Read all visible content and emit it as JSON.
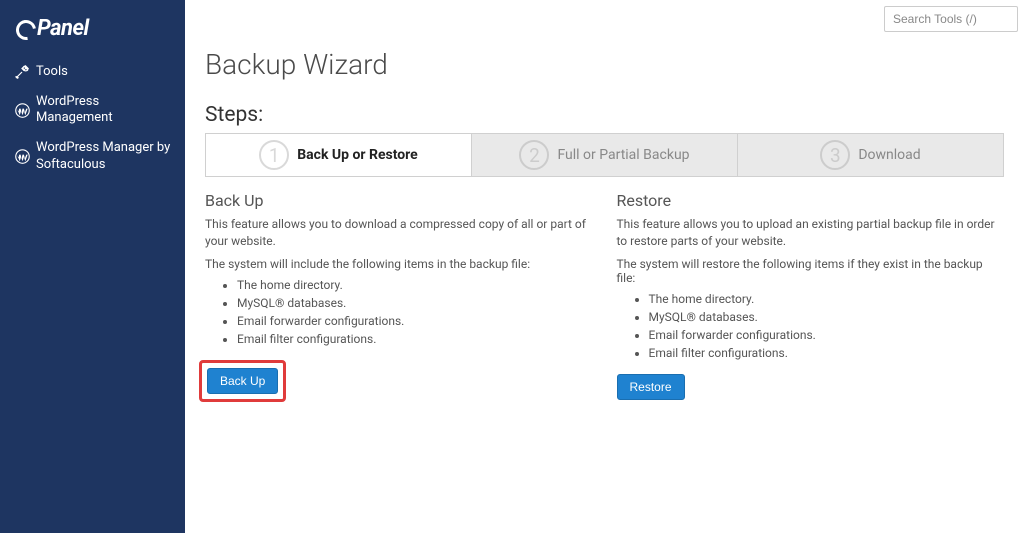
{
  "brand": {
    "name": "cPanel"
  },
  "search": {
    "placeholder": "Search Tools (/)"
  },
  "sidebar": {
    "items": [
      {
        "label": "Tools"
      },
      {
        "label": "WordPress Management"
      },
      {
        "label": "WordPress Manager by Softaculous"
      }
    ]
  },
  "page": {
    "title": "Backup Wizard",
    "steps_label": "Steps:"
  },
  "steps": [
    {
      "num": "1",
      "label": "Back Up or Restore"
    },
    {
      "num": "2",
      "label": "Full or Partial Backup"
    },
    {
      "num": "3",
      "label": "Download"
    }
  ],
  "backup": {
    "title": "Back Up",
    "desc": "This feature allows you to download a compressed copy of all or part of your website.",
    "sub": "The system will include the following items in the backup file:",
    "items": [
      "The home directory.",
      "MySQL® databases.",
      "Email forwarder configurations.",
      "Email filter configurations."
    ],
    "button": "Back Up"
  },
  "restore": {
    "title": "Restore",
    "desc": "This feature allows you to upload an existing partial backup file in order to restore parts of your website.",
    "sub": "The system will restore the following items if they exist in the backup file:",
    "items": [
      "The home directory.",
      "MySQL® databases.",
      "Email forwarder configurations.",
      "Email filter configurations."
    ],
    "button": "Restore"
  }
}
